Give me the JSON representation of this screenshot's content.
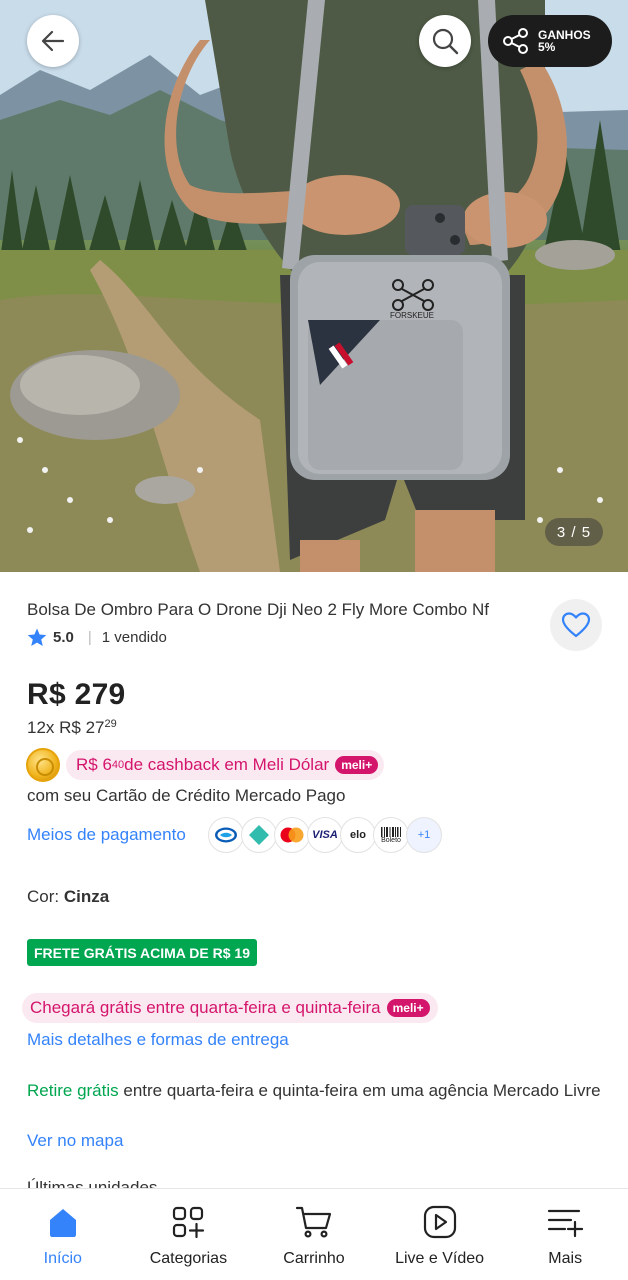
{
  "header": {
    "share_label_1": "GANHOS",
    "share_label_2": "5%",
    "image_counter": "3 / 5"
  },
  "product": {
    "title": "Bolsa De Ombro Para O Drone Dji Neo 2 Fly More Combo Nf",
    "rating": "5.0",
    "rating_sep": "|",
    "sold": "1 vendido",
    "price": "R$ 279",
    "installments_prefix": "12x R$ 27",
    "installments_cents": "29"
  },
  "cashback": {
    "prefix": "R$ 6",
    "cents": "40",
    "suffix": " de cashback em Meli Dólar",
    "badge": "meli+",
    "subtitle": "com seu Cartão de Crédito Mercado Pago"
  },
  "payments": {
    "link": "Meios de pagamento",
    "visa": "VISA",
    "elo": "elo",
    "boleto": "Boleto",
    "more": "+1"
  },
  "color": {
    "label": "Cor: ",
    "value": "Cinza"
  },
  "shipping": {
    "free_badge": "FRETE GRÁTIS ACIMA DE R$ 19",
    "arrival": "Chegará grátis entre quarta-feira e quinta-feira",
    "arrival_badge": "meli+",
    "details_link": "Mais detalhes e formas de entrega",
    "pickup_highlight": "Retire grátis",
    "pickup_text": " entre quarta-feira e quinta-feira em uma agência Mercado Livre",
    "map_link": "Ver no mapa",
    "cut_text": "Últimas unidades"
  },
  "nav": {
    "items": [
      {
        "label": "Início",
        "icon": "home-icon"
      },
      {
        "label": "Categorias",
        "icon": "categories-icon"
      },
      {
        "label": "Carrinho",
        "icon": "cart-icon"
      },
      {
        "label": "Live e Vídeo",
        "icon": "play-icon"
      },
      {
        "label": "Mais",
        "icon": "menu-plus-icon"
      }
    ]
  },
  "colors": {
    "accent_blue": "#3483fa",
    "meli_pink": "#d4156c",
    "free_green": "#00a650"
  }
}
